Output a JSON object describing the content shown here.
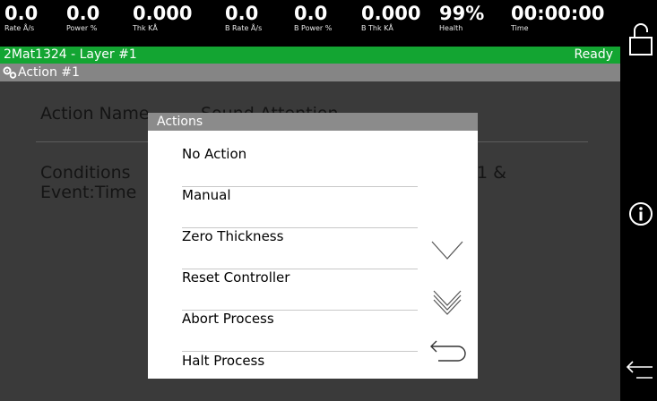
{
  "status": {
    "metrics": [
      {
        "value": "0.0",
        "label": "Rate Å/s"
      },
      {
        "value": "0.0",
        "label": "Power %"
      },
      {
        "value": "0.000",
        "label": "Thk KÅ"
      },
      {
        "value": "0.0",
        "label": "B Rate Å/s"
      },
      {
        "value": "0.0",
        "label": "B Power %"
      },
      {
        "value": "0.000",
        "label": "B Thk KÅ"
      },
      {
        "value": "99%",
        "label": "Health"
      },
      {
        "value": "00:00:00",
        "label": "Time"
      }
    ]
  },
  "titlebar": {
    "left": "2Mat1324 - Layer #1",
    "right": "Ready"
  },
  "breadcrumb": {
    "icon": "gears-icon",
    "label": "Action #1"
  },
  "background": {
    "action_name_label": "Action Name",
    "action_name_value": "Sound Attention",
    "conditions_label": "Conditions",
    "conditions_line2": "Event:Time",
    "conditions_fragment": "1 &"
  },
  "modal": {
    "title": "Actions",
    "items": [
      "No Action",
      "Manual",
      "Zero Thickness",
      "Reset Controller",
      "Abort Process",
      "Halt Process"
    ],
    "controls": [
      "scroll-down-icon",
      "page-down-icon",
      "back-icon"
    ]
  },
  "rail": {
    "icons": [
      "unlock-icon",
      "info-icon",
      "back-arrow-icon"
    ]
  },
  "colors": {
    "green": "#13a532",
    "grey_bar": "#858585",
    "modal_header": "#8b8b8b",
    "background": "#3a3a3a"
  }
}
